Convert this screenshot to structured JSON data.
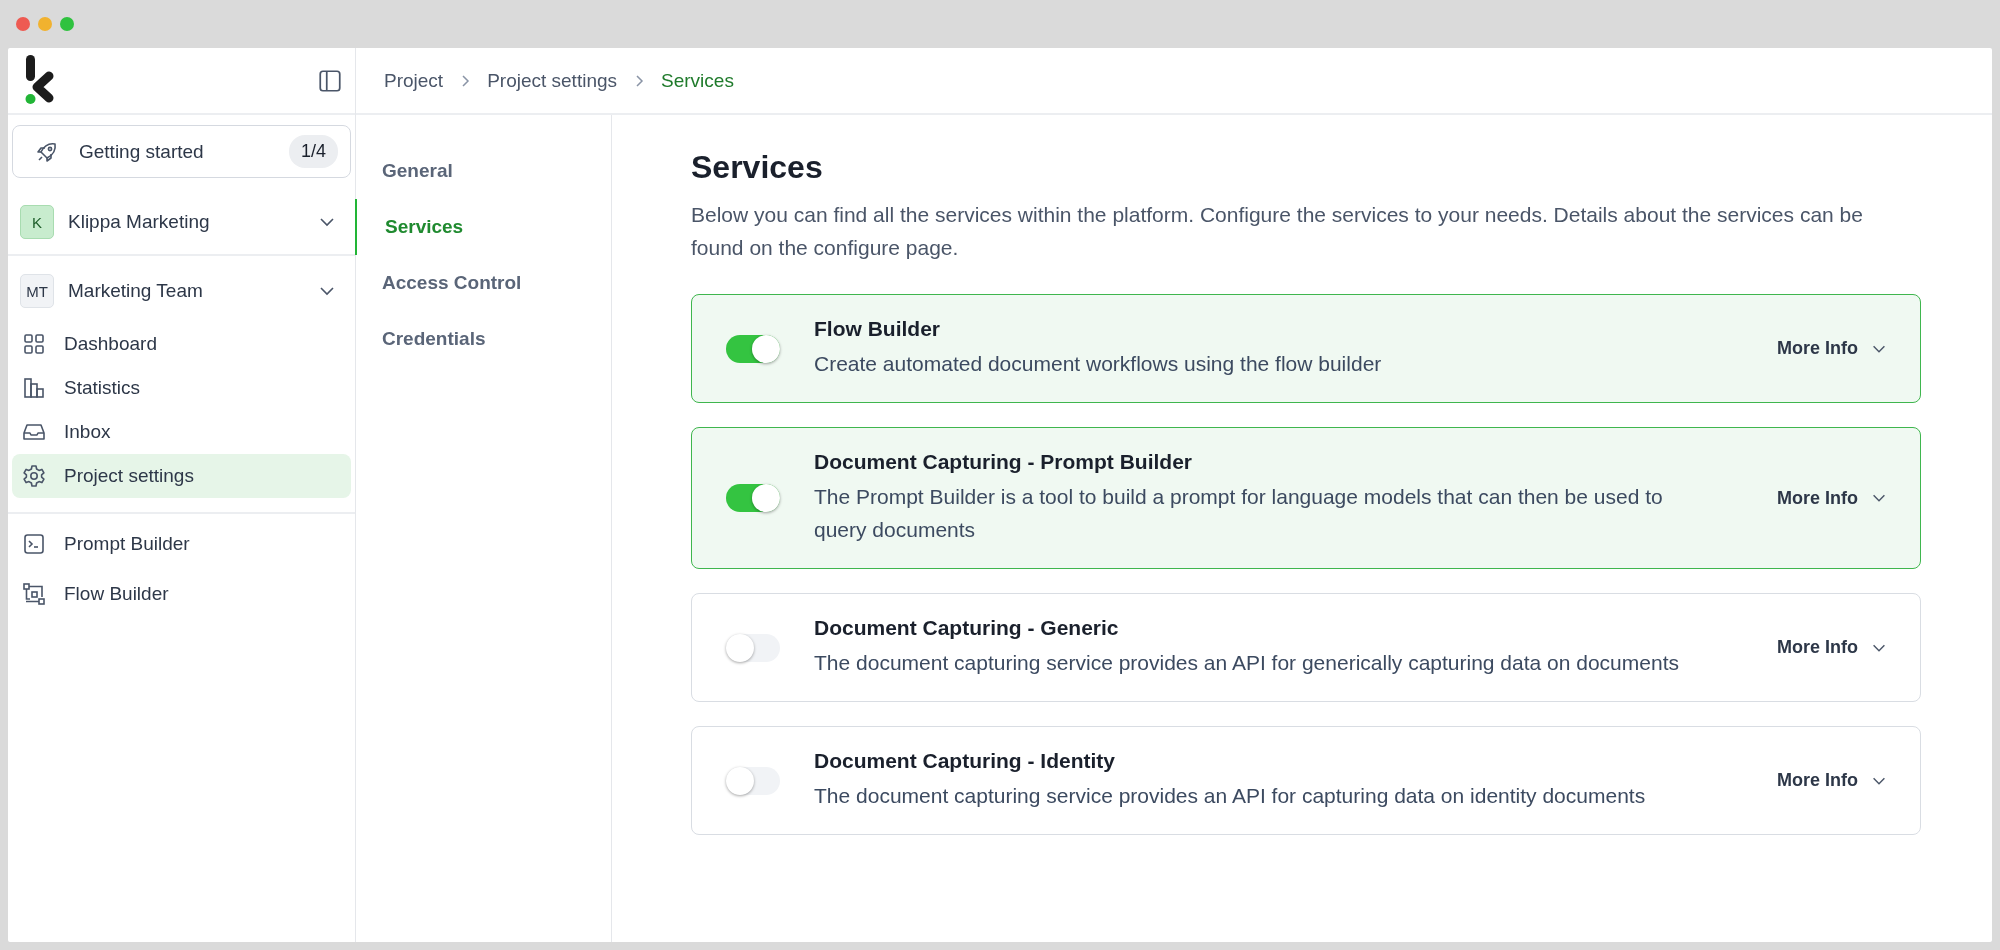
{
  "sidebar": {
    "getting_started": {
      "label": "Getting started",
      "badge": "1/4"
    },
    "organization": {
      "avatar": "K",
      "name": "Klippa Marketing"
    },
    "team": {
      "avatar": "MT",
      "name": "Marketing Team"
    },
    "items": [
      {
        "kind": "dashboard",
        "label": "Dashboard",
        "selected": false
      },
      {
        "kind": "statistics",
        "label": "Statistics",
        "selected": false
      },
      {
        "kind": "inbox",
        "label": "Inbox",
        "selected": false
      },
      {
        "kind": "settings",
        "label": "Project settings",
        "selected": true
      }
    ],
    "tools": [
      {
        "kind": "prompt",
        "label": "Prompt Builder"
      },
      {
        "kind": "flow",
        "label": "Flow Builder"
      }
    ]
  },
  "breadcrumb": [
    {
      "label": "Project",
      "selected": false
    },
    {
      "label": "Project settings",
      "selected": false
    },
    {
      "label": "Services",
      "selected": true
    }
  ],
  "settings_nav": [
    {
      "label": "General",
      "selected": false
    },
    {
      "label": "Services",
      "selected": true
    },
    {
      "label": "Access Control",
      "selected": false
    },
    {
      "label": "Credentials",
      "selected": false
    }
  ],
  "page": {
    "title": "Services",
    "description": "Below you can find all the services within the platform. Configure the services to your needs. Details about the services can be found on the configure page."
  },
  "services": [
    {
      "name": "Flow Builder",
      "description": "Create automated document workflows using the flow builder",
      "on": true,
      "more": "More Info"
    },
    {
      "name": "Document Capturing - Prompt Builder",
      "description": "The Prompt Builder is a tool to build a prompt for language models that can then be used to query documents",
      "on": true,
      "more": "More Info"
    },
    {
      "name": "Document Capturing - Generic",
      "description": "The document capturing service provides an API for generically capturing data on documents",
      "on": false,
      "more": "More Info"
    },
    {
      "name": "Document Capturing - Identity",
      "description": "The document capturing service provides an API for capturing data on identity documents",
      "on": false,
      "more": "More Info"
    }
  ]
}
